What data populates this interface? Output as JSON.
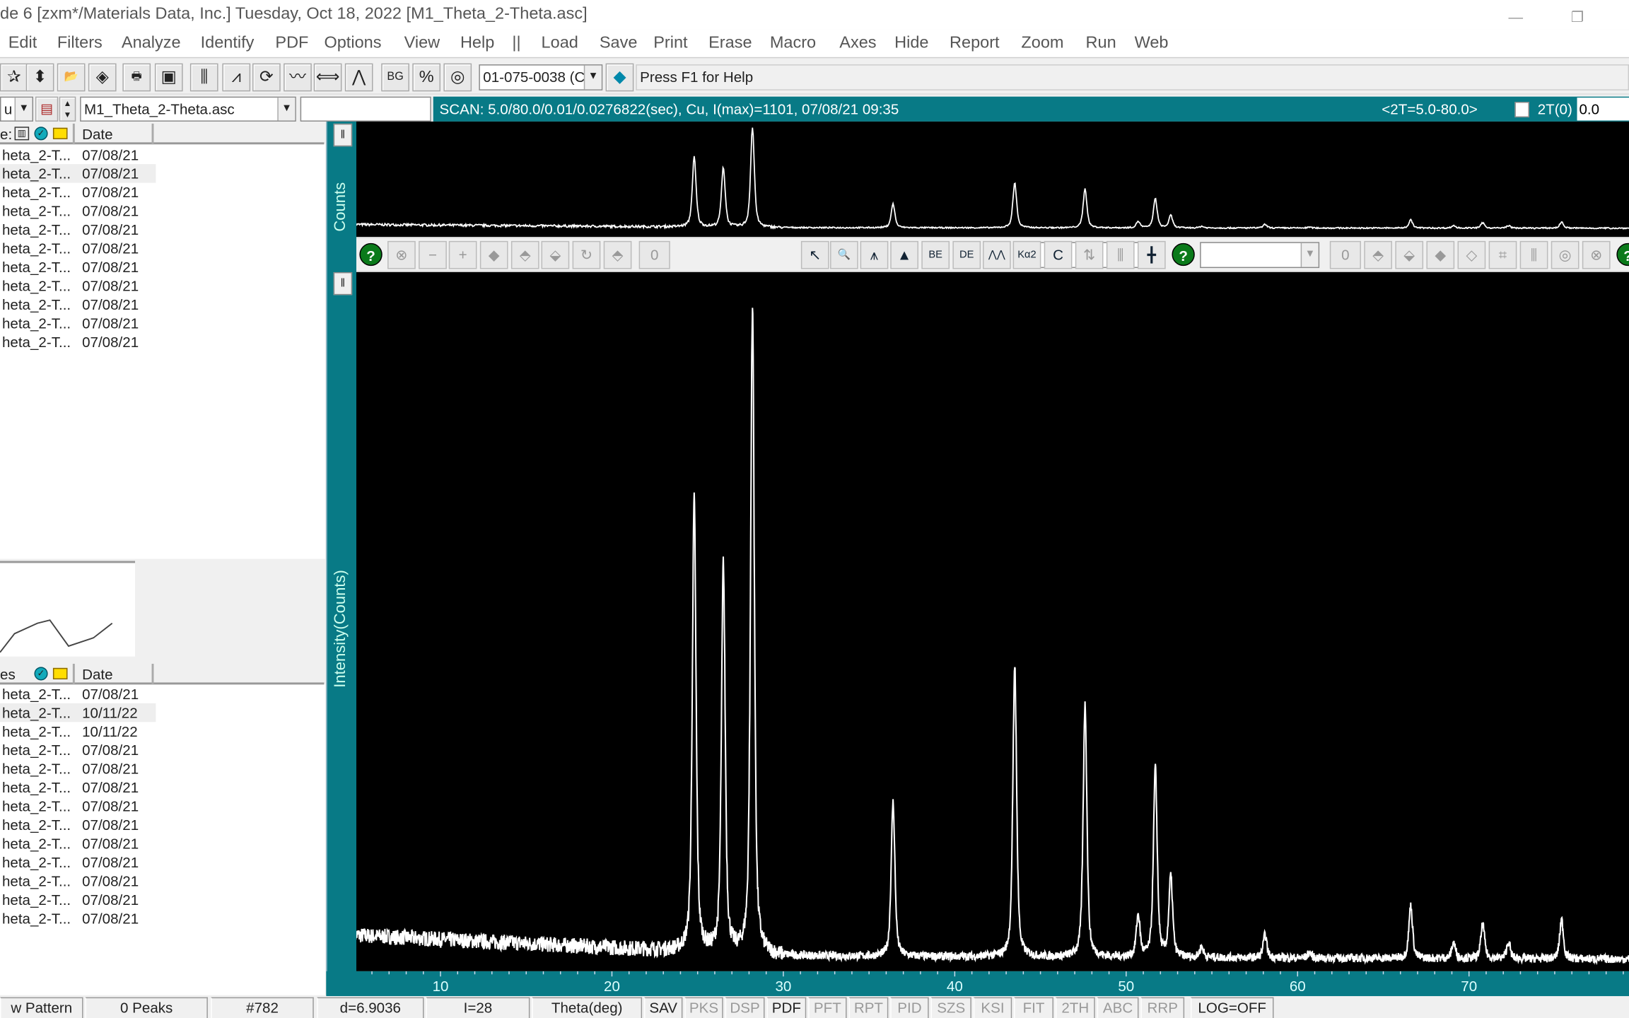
{
  "window": {
    "title": "de 6 [zxm*/Materials Data, Inc.] Tuesday, Oct 18, 2022 [M1_Theta_2-Theta.asc]",
    "minimize": "—",
    "restore": "❐"
  },
  "menu": [
    "Edit",
    "Filters",
    "Analyze",
    "Identify",
    "PDF",
    "Options",
    "View",
    "Help",
    "||",
    "Load",
    "Save",
    "Print",
    "Erase",
    "Macro",
    "Axes",
    "Hide",
    "Report",
    "Zoom",
    "Run",
    "Web"
  ],
  "toolbar": {
    "buttons": [
      {
        "name": "star-filter-icon",
        "glyph": "✰"
      },
      {
        "name": "up-down-icon",
        "glyph": "⬍"
      },
      {
        "name": "open-folder-icon",
        "glyph": "📂"
      },
      {
        "name": "erase-icon",
        "glyph": "◈"
      },
      {
        "name": "print-icon",
        "glyph": "🖶"
      },
      {
        "name": "save-disk-icon",
        "glyph": "▣"
      },
      {
        "name": "bar-pattern-icon",
        "glyph": "⫼"
      },
      {
        "name": "smooth-icon",
        "glyph": "⩘"
      },
      {
        "name": "refresh-icon",
        "glyph": "⟳"
      },
      {
        "name": "noise-icon",
        "glyph": "〰"
      },
      {
        "name": "align-icon",
        "glyph": "⟺"
      },
      {
        "name": "peaks-icon",
        "glyph": "⋀"
      },
      {
        "name": "background-icon",
        "glyph": "BG"
      },
      {
        "name": "s-m-icon",
        "glyph": "%"
      },
      {
        "name": "disc-icon",
        "glyph": "◎"
      }
    ],
    "pdf_combo": "01-075-0038 (C",
    "hint": "Press F1 for Help"
  },
  "row3": {
    "left_combo": "u",
    "file_combo": "M1_Theta_2-Theta.asc",
    "blank_input": "",
    "scan_info": "SCAN: 5.0/80.0/0.01/0.0276822(sec), Cu, I(max)=1101, 07/08/21 09:35",
    "range": "<2T=5.0-80.0>",
    "twotheta_zero_label": "2T(0)",
    "twotheta_zero_value": "0.0"
  },
  "left_panel": {
    "list1": {
      "col_name": "e:",
      "col_date": "Date",
      "rows": [
        [
          "heta_2-T...",
          "07/08/21"
        ],
        [
          "heta_2-T...",
          "07/08/21"
        ],
        [
          "heta_2-T...",
          "07/08/21"
        ],
        [
          "heta_2-T...",
          "07/08/21"
        ],
        [
          "heta_2-T...",
          "07/08/21"
        ],
        [
          "heta_2-T...",
          "07/08/21"
        ],
        [
          "heta_2-T...",
          "07/08/21"
        ],
        [
          "heta_2-T...",
          "07/08/21"
        ],
        [
          "heta_2-T...",
          "07/08/21"
        ],
        [
          "heta_2-T...",
          "07/08/21"
        ],
        [
          "heta_2-T...",
          "07/08/21"
        ]
      ],
      "selected": 1
    },
    "list2": {
      "col_name": "es",
      "col_date": "Date",
      "rows": [
        [
          "heta_2-T...",
          "07/08/21"
        ],
        [
          "heta_2-T...",
          "10/11/22"
        ],
        [
          "heta_2-T...",
          "10/11/22"
        ],
        [
          "heta_2-T...",
          "07/08/21"
        ],
        [
          "heta_2-T...",
          "07/08/21"
        ],
        [
          "heta_2-T...",
          "07/08/21"
        ],
        [
          "heta_2-T...",
          "07/08/21"
        ],
        [
          "heta_2-T...",
          "07/08/21"
        ],
        [
          "heta_2-T...",
          "07/08/21"
        ],
        [
          "heta_2-T...",
          "07/08/21"
        ],
        [
          "heta_2-T...",
          "07/08/21"
        ],
        [
          "heta_2-T...",
          "07/08/21"
        ],
        [
          "heta_2-T...",
          "07/08/21"
        ]
      ],
      "selected": 1
    }
  },
  "plot_toolbar": {
    "field_value": "0",
    "field2_value": "0",
    "buttons": [
      {
        "name": "help-icon",
        "glyph": "?",
        "help": true
      },
      {
        "name": "cancel-icon",
        "glyph": "⊗"
      },
      {
        "name": "minus-icon",
        "glyph": "−"
      },
      {
        "name": "plus-icon",
        "glyph": "+"
      },
      {
        "name": "left-right-icon",
        "glyph": "◆"
      },
      {
        "name": "up-icon",
        "glyph": "⬘"
      },
      {
        "name": "updown-icon",
        "glyph": "⬙"
      },
      {
        "name": "rotate-icon",
        "glyph": "↻"
      },
      {
        "name": "shift-icon",
        "glyph": "⬘"
      },
      {
        "name": "cursor-icon",
        "glyph": "↖",
        "on": true
      },
      {
        "name": "zoom-icon",
        "glyph": "🔍",
        "on": true
      },
      {
        "name": "peak-marker-icon",
        "glyph": "⩚",
        "on": true
      },
      {
        "name": "fill-peak-icon",
        "glyph": "▲",
        "on": true
      },
      {
        "name": "be-icon",
        "glyph": "BE",
        "on": true
      },
      {
        "name": "de-icon",
        "glyph": "DE",
        "on": true
      },
      {
        "name": "doublet-icon",
        "glyph": "⋀⋀",
        "on": true
      },
      {
        "name": "ka2-icon",
        "glyph": "Kα2",
        "on": true
      },
      {
        "name": "c-icon",
        "glyph": "C",
        "on": true
      },
      {
        "name": "arrow-peaks-icon",
        "glyph": "⇅"
      },
      {
        "name": "bars-icon",
        "glyph": "⫼"
      },
      {
        "name": "crosshair-icon",
        "glyph": "╋",
        "on": true
      },
      {
        "name": "help2-icon",
        "glyph": "?",
        "help": true
      }
    ],
    "right_buttons": [
      {
        "name": "up2-icon",
        "glyph": "⬘"
      },
      {
        "name": "updown2-icon",
        "glyph": "⬙"
      },
      {
        "name": "lr2-icon",
        "glyph": "◆"
      },
      {
        "name": "lr3-icon",
        "glyph": "◇"
      },
      {
        "name": "fit-icon",
        "glyph": "⌗"
      },
      {
        "name": "bar2-icon",
        "glyph": "⫼"
      },
      {
        "name": "disc2-icon",
        "glyph": "◎"
      },
      {
        "name": "cancel2-icon",
        "glyph": "⊗"
      },
      {
        "name": "help3-icon",
        "glyph": "?",
        "help": true
      }
    ]
  },
  "status": [
    {
      "label": "w Pattern",
      "dim": false
    },
    {
      "label": "0 Peaks",
      "dim": false
    },
    {
      "label": "#782",
      "dim": false
    },
    {
      "label": "d=6.9036",
      "dim": false
    },
    {
      "label": "I=28",
      "dim": false
    },
    {
      "label": "Theta(deg)",
      "dim": false
    },
    {
      "label": "SAV",
      "dim": false
    },
    {
      "label": "PKS",
      "dim": true
    },
    {
      "label": "DSP",
      "dim": true
    },
    {
      "label": "PDF",
      "dim": false
    },
    {
      "label": "PFT",
      "dim": true
    },
    {
      "label": "RPT",
      "dim": true
    },
    {
      "label": "PID",
      "dim": true
    },
    {
      "label": "SZS",
      "dim": true
    },
    {
      "label": "KSI",
      "dim": true
    },
    {
      "label": "FIT",
      "dim": true
    },
    {
      "label": "2TH",
      "dim": true
    },
    {
      "label": "ABC",
      "dim": true
    },
    {
      "label": "RRP",
      "dim": true
    },
    {
      "label": "LOG=OFF",
      "dim": false
    }
  ],
  "chart_data": {
    "type": "line",
    "xlabel": "",
    "ylabel": "Intensity(Counts)",
    "overview_ylabel": "Counts",
    "xlim": [
      5,
      80
    ],
    "ylim": [
      0,
      1160
    ],
    "x_ticks": [
      10,
      20,
      30,
      40,
      50,
      60,
      70
    ],
    "grid": false,
    "line_color": "#ffffff",
    "background": "#000000",
    "peaks": [
      [
        24.8,
        780
      ],
      [
        26.5,
        671
      ],
      [
        28.2,
        1101
      ],
      [
        36.4,
        277
      ],
      [
        43.5,
        506
      ],
      [
        47.6,
        440
      ],
      [
        50.7,
        87
      ],
      [
        51.7,
        333
      ],
      [
        52.6,
        151
      ],
      [
        54.4,
        35
      ],
      [
        58.1,
        55
      ],
      [
        60.7,
        26
      ],
      [
        66.6,
        104
      ],
      [
        69.1,
        43
      ],
      [
        70.8,
        73
      ],
      [
        72.3,
        43
      ],
      [
        75.4,
        81
      ]
    ],
    "background_counts": [
      [
        5,
        55
      ],
      [
        30,
        20
      ],
      [
        80,
        15
      ]
    ]
  }
}
